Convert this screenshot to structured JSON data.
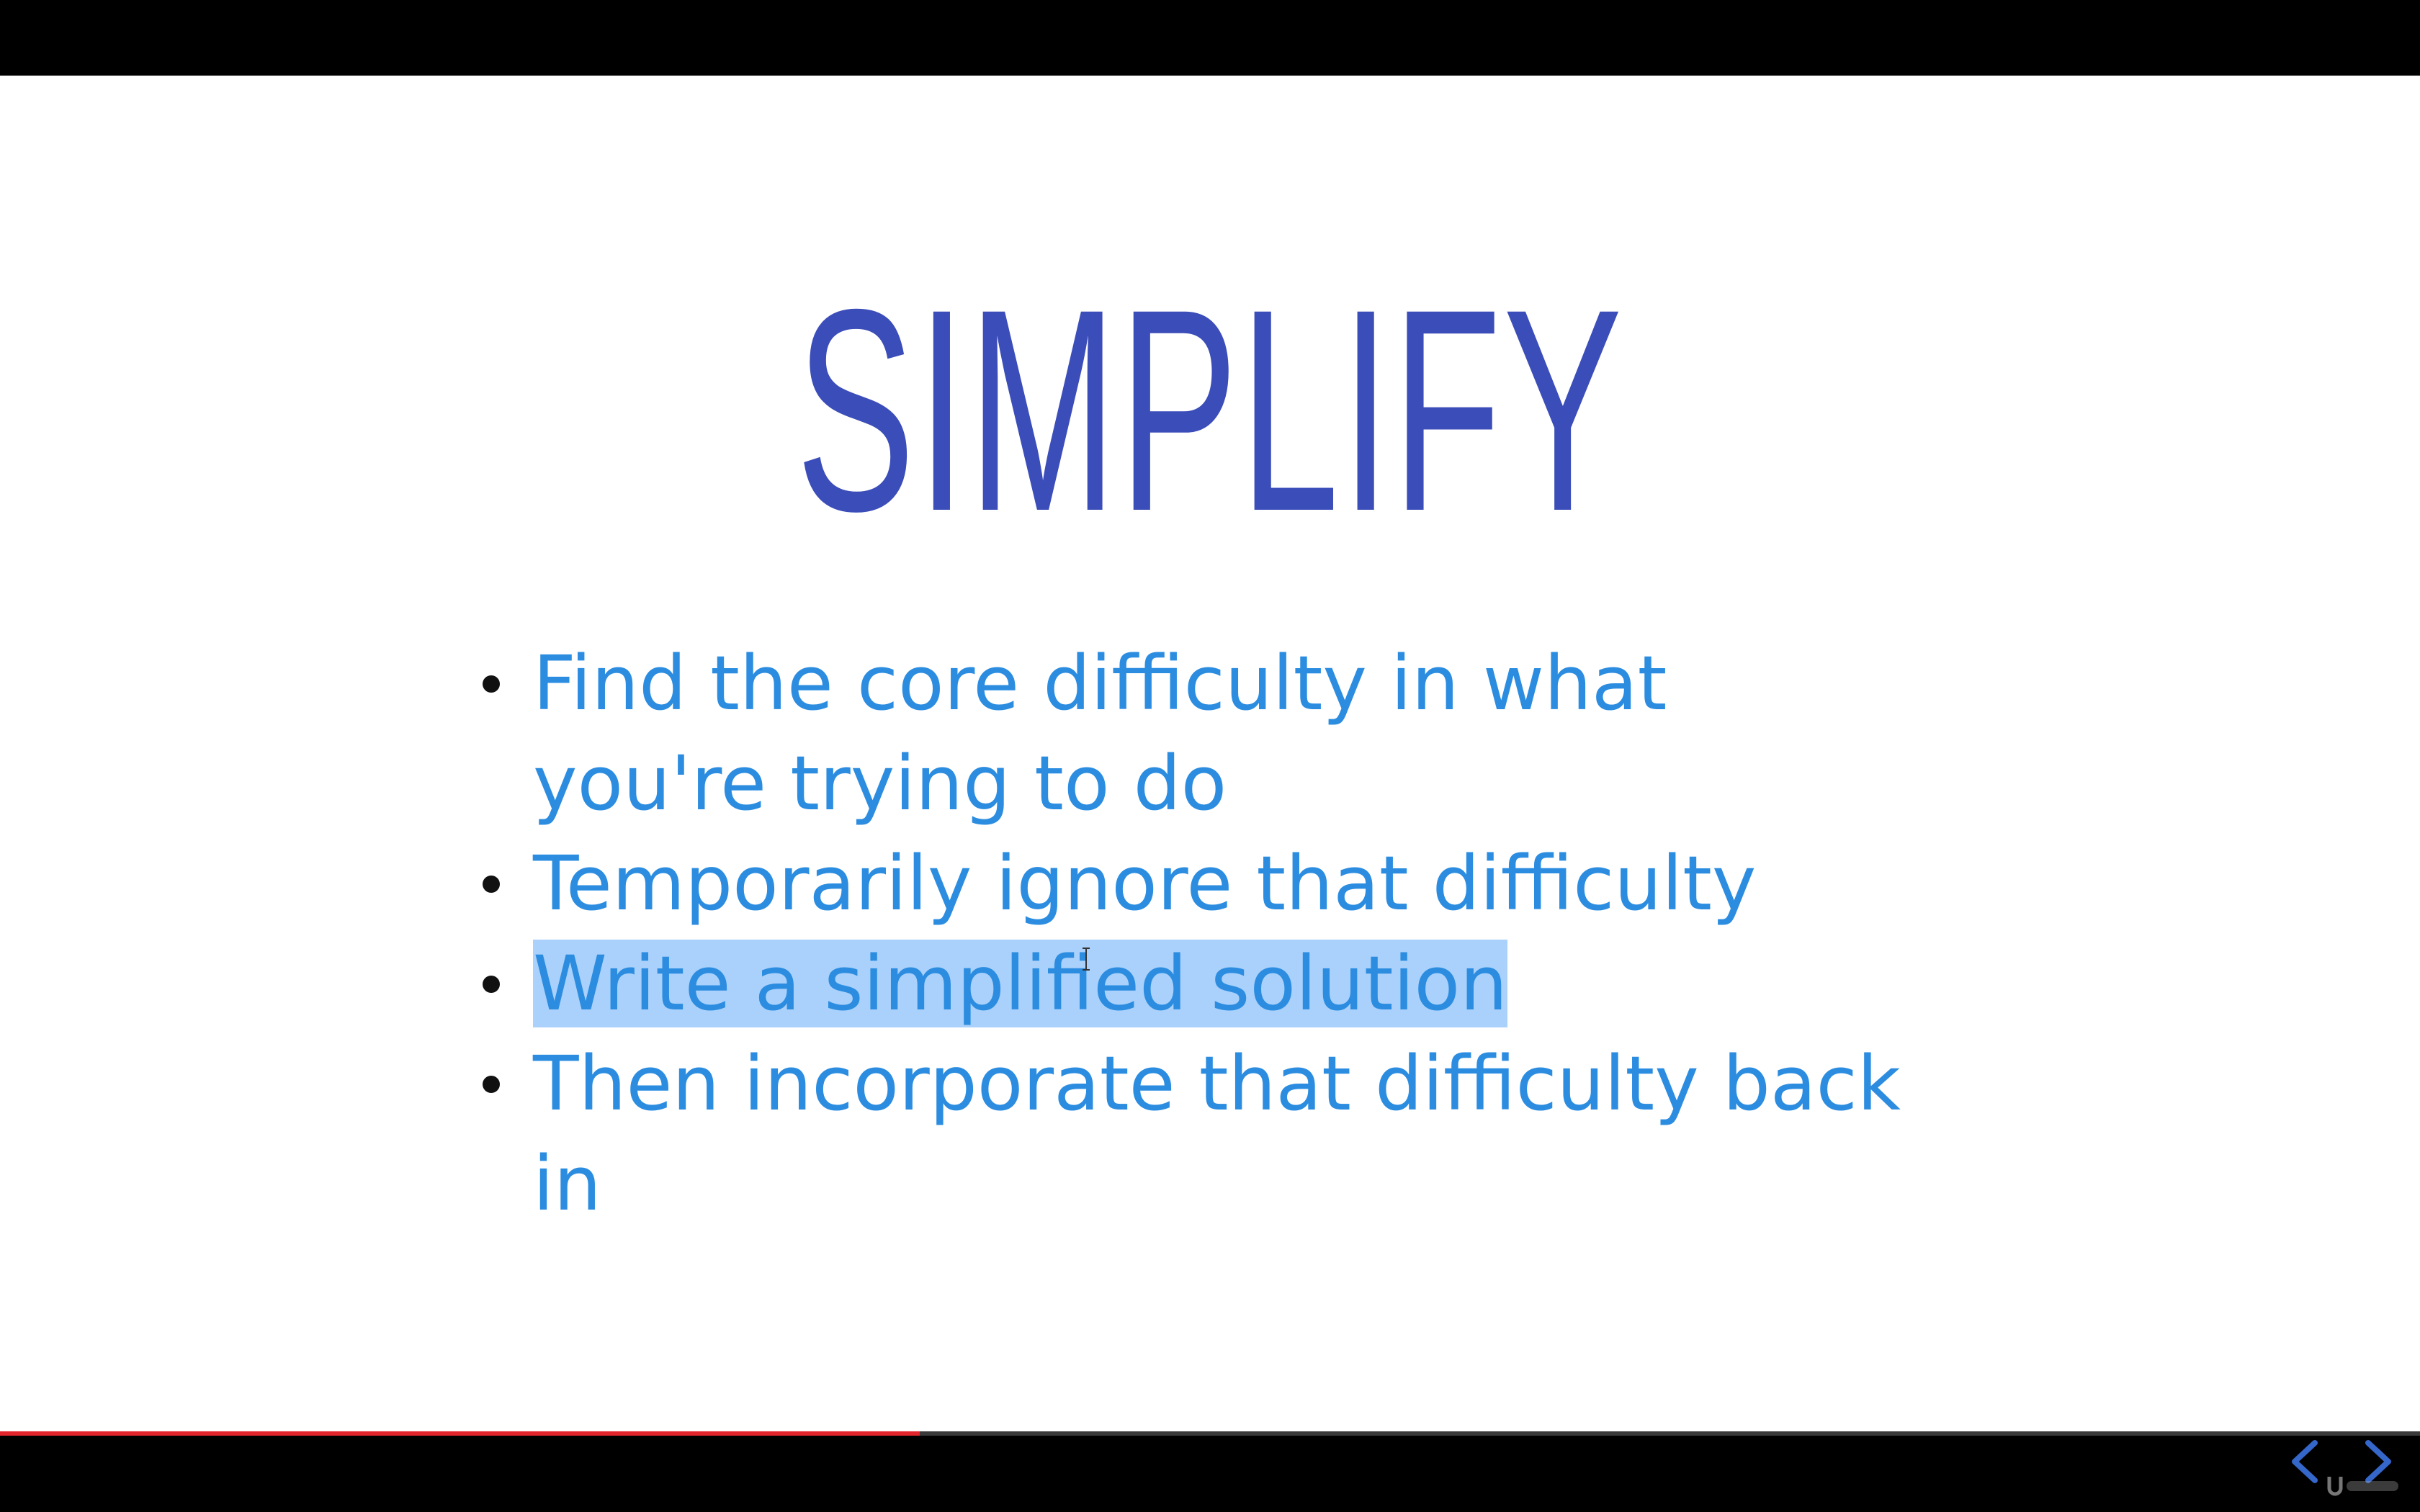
{
  "slide": {
    "title": "SIMPLIFY",
    "title_color": "#3b4db8",
    "bullet_color": "#2c8de0",
    "highlight_color": "#aad1fb",
    "bullets": [
      {
        "text": "Find the core difficulty in what you're trying to do",
        "highlighted": false
      },
      {
        "text": "Temporarily ignore that difficulty",
        "highlighted": false
      },
      {
        "text": "Write a simplified solution",
        "highlighted": true
      },
      {
        "text": "Then incorporate that difficulty back in",
        "highlighted": false
      }
    ]
  },
  "player": {
    "progress": 0.38,
    "progress_color": "#e3262d",
    "prev_icon": "chevron-left-icon",
    "next_icon": "chevron-right-icon",
    "nav_color": "#3566c9",
    "watermark_icon": "udemy-logo-icon"
  }
}
